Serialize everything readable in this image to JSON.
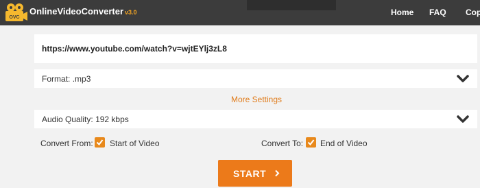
{
  "header": {
    "logo_text": "OnlineVideoConverter",
    "version": "v3.0",
    "logo_badge": "OVC",
    "nav": [
      "Home",
      "FAQ",
      "Copy"
    ],
    "logo_icon": "film-reel-icon"
  },
  "form": {
    "url_value": "https://www.youtube.com/watch?v=wjtEYlj3zL8",
    "format_label": "Format:",
    "format_value": ".mp3",
    "more_settings": "More Settings",
    "quality_label": "Audio Quality:",
    "quality_value": "192 kbps",
    "convert_from_label": "Convert From:",
    "convert_from_value": "Start of Video",
    "convert_from_checked": true,
    "convert_to_label": "Convert To:",
    "convert_to_value": "End of Video",
    "convert_to_checked": true,
    "start_label": "START"
  },
  "colors": {
    "topbar": "#3c3c3c",
    "accent": "#ec7a1a",
    "link": "#e07b1a",
    "background": "#f2f2f2"
  },
  "icons": {
    "dropdown": "chevron-down-icon",
    "checkbox": "checkmark-icon",
    "start": "chevron-right-icon"
  }
}
